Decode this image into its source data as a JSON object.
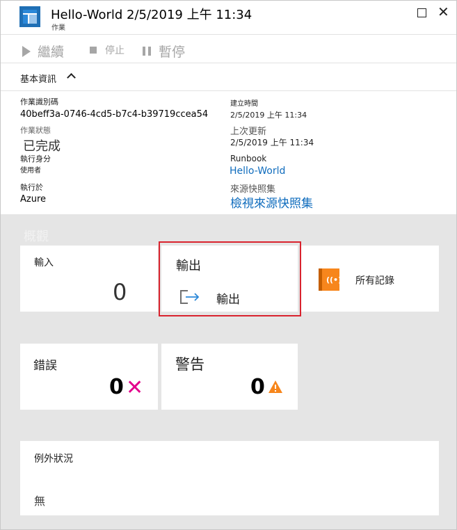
{
  "header": {
    "title": "Hello-World 2/5/2019 上午 11:34",
    "subtitle": "作業"
  },
  "toolbar": {
    "resume_label": "繼續",
    "stop_label": "停止",
    "suspend_label": "暫停"
  },
  "essentials": {
    "toggle_label": "基本資訊",
    "job_id_key": "作業識別碼",
    "job_id_value": "40beff3a-0746-4cd5-b7c4-b39719ccea54",
    "status_key": "作業狀態",
    "status_value": "已完成",
    "ran_as_key": "執行身分",
    "ran_as_value": "使用者",
    "ran_on_key": "執行於",
    "ran_on_value": "Azure",
    "created_key": "建立時間",
    "created_value": "2/5/2019 上午 11:34",
    "updated_key": "上次更新",
    "updated_value": "2/5/2019 上午 11:34",
    "runbook_key": "Runbook",
    "runbook_value": "Hello-World",
    "snapshot_key": "來源快照集",
    "snapshot_value": "檢視來源快照集"
  },
  "overview": {
    "title": "概觀",
    "input_label": "輸入",
    "input_count": "0",
    "output_label": "輸出",
    "output_link": "輸出",
    "all_logs_label": "所有記錄",
    "errors_label": "錯誤",
    "errors_count": "0",
    "warnings_label": "警告",
    "warnings_count": "0",
    "exception_label": "例外狀況",
    "exception_value": "無"
  },
  "colors": {
    "accent": "#0f6cbd",
    "highlight": "#d9232e",
    "error": "#e3008c",
    "warning": "#f7861c"
  }
}
